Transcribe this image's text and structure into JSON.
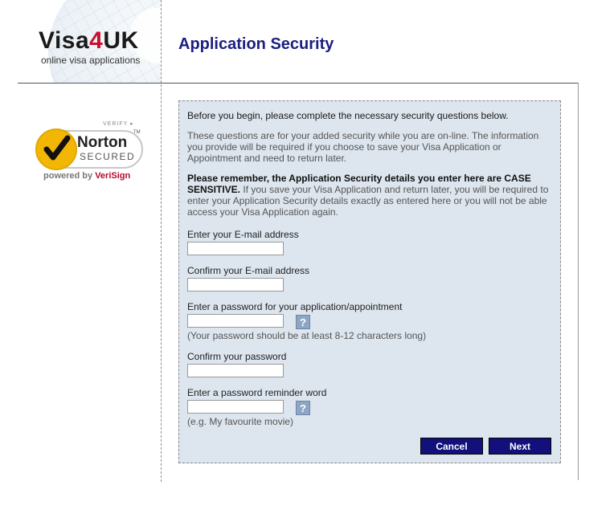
{
  "header": {
    "logo_main_prefix": "Visa",
    "logo_main_number": "4",
    "logo_main_suffix": "UK",
    "logo_sub": "online visa applications",
    "page_title": "Application Security"
  },
  "seal": {
    "verify": "VERIFY ▸",
    "name": "Norton",
    "secured": "SECURED",
    "tm": "TM",
    "powered_by": "powered by ",
    "verisign": "VeriSign"
  },
  "form": {
    "intro": "Before you begin, please complete the necessary security questions below.",
    "info": "These questions are for your added security while you are on-line.  The information you provide will be required if you choose to save your Visa Application or Appointment and need to return later.",
    "remember_bold": "Please remember, the Application Security details you enter here are CASE SENSITIVE.",
    "remember_rest": " If you save your Visa Application and return later, you will be required to enter your Application Security details exactly as entered here or you will not be able access your Visa Application again.",
    "email_label": "Enter your E-mail address",
    "email_value": "",
    "confirm_email_label": "Confirm your E-mail address",
    "confirm_email_value": "",
    "password_label": "Enter a password for your application/appointment",
    "password_value": "",
    "password_hint": "(Your password should be at least 8-12 characters long)",
    "confirm_password_label": "Confirm your password",
    "confirm_password_value": "",
    "reminder_label": "Enter a password reminder word",
    "reminder_value": "",
    "reminder_hint": "(e.g. My favourite movie)",
    "help_glyph": "?",
    "cancel_label": "Cancel",
    "next_label": "Next"
  }
}
